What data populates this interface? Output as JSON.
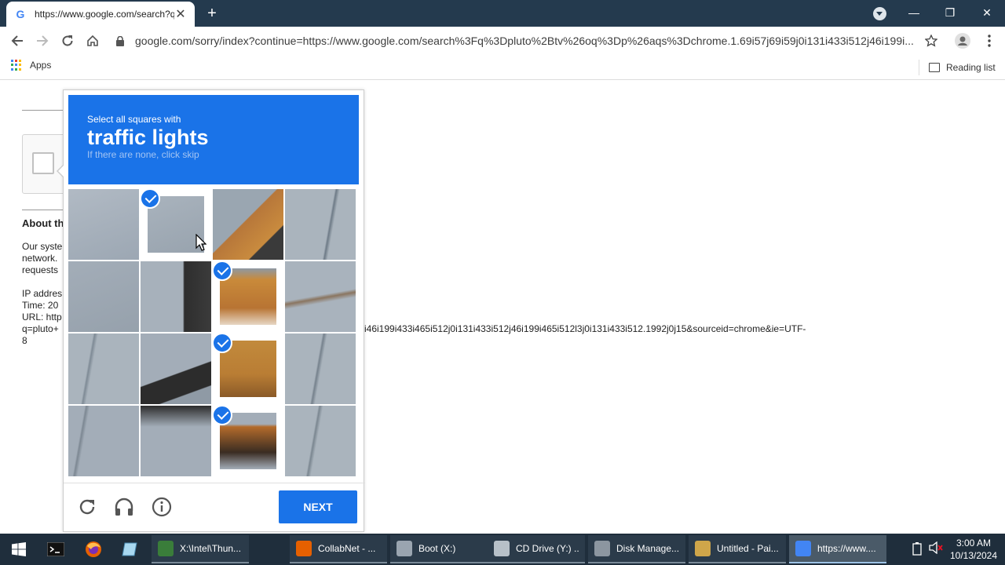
{
  "browser": {
    "tab_title": "https://www.google.com/search?q",
    "tab_close": "✕",
    "new_tab": "+",
    "url": "google.com/sorry/index?continue=https://www.google.com/search%3Fq%3Dpluto%2Btv%26oq%3Dp%26aqs%3Dchrome.1.69i57j69i59j0i131i433i512j46i199i...",
    "bookmarks": {
      "apps_label": "Apps",
      "reading_list_label": "Reading list"
    }
  },
  "page": {
    "about_heading": "About th",
    "lines": [
      "Our syste",
      "network.",
      "requests"
    ],
    "ip_line": "IP addres",
    "time_line": "Time: 20",
    "url_line": "URL: http",
    "q_line": "q=pluto+",
    "q_line_tail": "i46i199i433i465i512j0i131i433i512j46i199i465i512l3j0i131i433i512.1992j0j15&sourceid=chrome&ie=UTF-",
    "last_line": "8"
  },
  "captcha": {
    "instruction": "Select all squares with",
    "target": "traffic lights",
    "hint": "If there are none, click skip",
    "next_label": "NEXT",
    "selected_tiles": [
      1,
      6,
      10,
      14
    ],
    "icons": {
      "reload": "reload-icon",
      "audio": "headphones-icon",
      "info": "info-icon"
    }
  },
  "taskbar": {
    "items": [
      {
        "label": "X:\\Intel\\Thun...",
        "icon": "notepad-icon",
        "color": "#3a7d3a"
      },
      {
        "label": "CollabNet - ...",
        "icon": "firefox-icon",
        "color": "#e66000"
      },
      {
        "label": "Boot (X:)",
        "icon": "drive-icon",
        "color": "#9aa5b0"
      },
      {
        "label": "CD Drive (Y:) ...",
        "icon": "cd-drive-icon",
        "color": "#b7c0c8"
      },
      {
        "label": "Disk Manage...",
        "icon": "disk-management-icon",
        "color": "#8c96a0"
      },
      {
        "label": "Untitled - Pai...",
        "icon": "paint-icon",
        "color": "#cfa64a"
      },
      {
        "label": "https://www....",
        "icon": "chrome-icon",
        "color": "#4285f4"
      }
    ],
    "time": "3:00 AM",
    "date": "10/13/2024"
  }
}
